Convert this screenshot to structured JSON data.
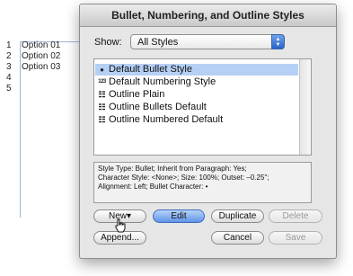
{
  "document": {
    "lines": [
      {
        "number": "1",
        "text": "Option 01"
      },
      {
        "number": "2",
        "text": "Option 02"
      },
      {
        "number": "3",
        "text": "Option 03"
      },
      {
        "number": "4",
        "text": ""
      },
      {
        "number": "5",
        "text": ""
      }
    ]
  },
  "dialog": {
    "title": "Bullet, Numbering, and Outline Styles",
    "show_label": "Show:",
    "show_value": "All Styles",
    "styles": [
      {
        "label": "Default Bullet Style",
        "icon": "bullet-icon",
        "selected": true
      },
      {
        "label": "Default Numbering Style",
        "icon": "numbering-icon",
        "selected": false
      },
      {
        "label": "Outline Plain",
        "icon": "outline-icon",
        "selected": false
      },
      {
        "label": "Outline Bullets Default",
        "icon": "outline-icon",
        "selected": false
      },
      {
        "label": "Outline Numbered Default",
        "icon": "outline-icon",
        "selected": false
      }
    ],
    "info": {
      "line1": "Style Type: Bullet;   Inherit from Paragraph: Yes;",
      "line2": "Character Style: <None>;   Size: 100%;   Outset: –0.25\";",
      "line3": "Alignment: Left;   Bullet Character: •"
    },
    "buttons": {
      "new": "New",
      "new_arrow": "▾",
      "edit": "Edit",
      "duplicate": "Duplicate",
      "delete": "Delete",
      "append": "Append...",
      "cancel": "Cancel",
      "save": "Save"
    }
  },
  "icons": {
    "bullet": "●",
    "numbering": "123",
    "outline": "☷"
  },
  "colors": {
    "selection": "#b5d0f5",
    "default_button": "#5f95e6"
  }
}
